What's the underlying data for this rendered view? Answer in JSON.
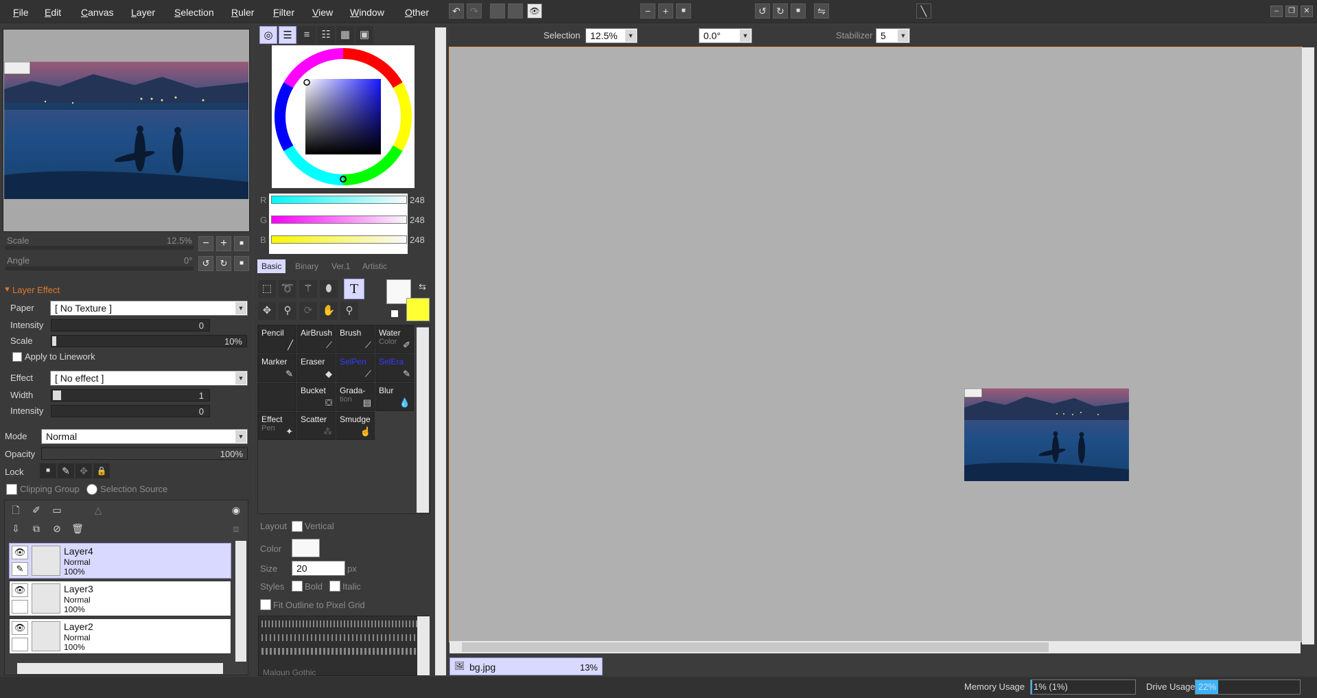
{
  "menu": [
    "File",
    "Edit",
    "Canvas",
    "Layer",
    "Selection",
    "Ruler",
    "Filter",
    "View",
    "Window",
    "Other"
  ],
  "navigator": {
    "scale_label": "Scale",
    "scale_value": "12.5%",
    "angle_label": "Angle",
    "angle_value": "0°"
  },
  "layer_effect": {
    "header": "Layer Effect",
    "paper_label": "Paper",
    "paper_value": "[ No Texture ]",
    "intensity_label": "Intensity",
    "intensity_value": "0",
    "scale_label": "Scale",
    "scale_value": "10%",
    "apply_linework": "Apply to Linework",
    "effect_label": "Effect",
    "effect_value": "[ No effect ]",
    "width_label": "Width",
    "width_value": "1",
    "intensity2_label": "Intensity",
    "intensity2_value": "0"
  },
  "layer_props": {
    "mode_label": "Mode",
    "mode_value": "Normal",
    "opacity_label": "Opacity",
    "opacity_value": "100%",
    "lock_label": "Lock",
    "clipping_group": "Clipping Group",
    "selection_source": "Selection Source"
  },
  "layers": [
    {
      "name": "Layer4",
      "mode": "Normal",
      "opacity": "100%",
      "selected": true
    },
    {
      "name": "Layer3",
      "mode": "Normal",
      "opacity": "100%",
      "selected": false
    },
    {
      "name": "Layer2",
      "mode": "Normal",
      "opacity": "100%",
      "selected": false
    }
  ],
  "color": {
    "r_label": "R",
    "r_value": "248",
    "g_label": "G",
    "g_value": "248",
    "b_label": "B",
    "b_value": "248",
    "primary": "#f8f8f8",
    "secondary": "#ffff33"
  },
  "tool_tabs": [
    "Basic",
    "Binary",
    "Ver.1",
    "Artistic"
  ],
  "brushes": [
    {
      "name": "Pencil",
      "sub": ""
    },
    {
      "name": "AirBrush",
      "sub": ""
    },
    {
      "name": "Brush",
      "sub": ""
    },
    {
      "name": "Water",
      "sub": "Color"
    },
    {
      "name": "Marker",
      "sub": ""
    },
    {
      "name": "Eraser",
      "sub": ""
    },
    {
      "name": "SelPen",
      "sub": ""
    },
    {
      "name": "SelEra",
      "sub": ""
    },
    {
      "name": "",
      "sub": ""
    },
    {
      "name": "Bucket",
      "sub": ""
    },
    {
      "name": "Grada-",
      "sub": "tion"
    },
    {
      "name": "Blur",
      "sub": ""
    },
    {
      "name": "Effect",
      "sub": "Pen"
    },
    {
      "name": "Scatter",
      "sub": ""
    },
    {
      "name": "Smudge",
      "sub": ""
    }
  ],
  "text_tool": {
    "layout_label": "Layout",
    "vertical_label": "Vertical",
    "color_label": "Color",
    "size_label": "Size",
    "size_value": "20",
    "size_unit": "px",
    "styles_label": "Styles",
    "bold_label": "Bold",
    "italic_label": "Italic",
    "fit_label": "Fit Outline to Pixel Grid",
    "font_name": "Malgun Gothic"
  },
  "toolbar": {
    "selection_label": "Selection",
    "zoom_value": "12.5%",
    "angle_value": "0.0°",
    "stabilizer_label": "Stabilizer",
    "stabilizer_value": "5"
  },
  "document_tab": {
    "name": "bg.jpg",
    "zoom": "13%"
  },
  "status": {
    "memory_label": "Memory Usage",
    "memory_value": "1% (1%)",
    "memory_fraction": 0.01,
    "drive_label": "Drive Usage",
    "drive_value": "22%",
    "drive_fraction": 0.22
  }
}
